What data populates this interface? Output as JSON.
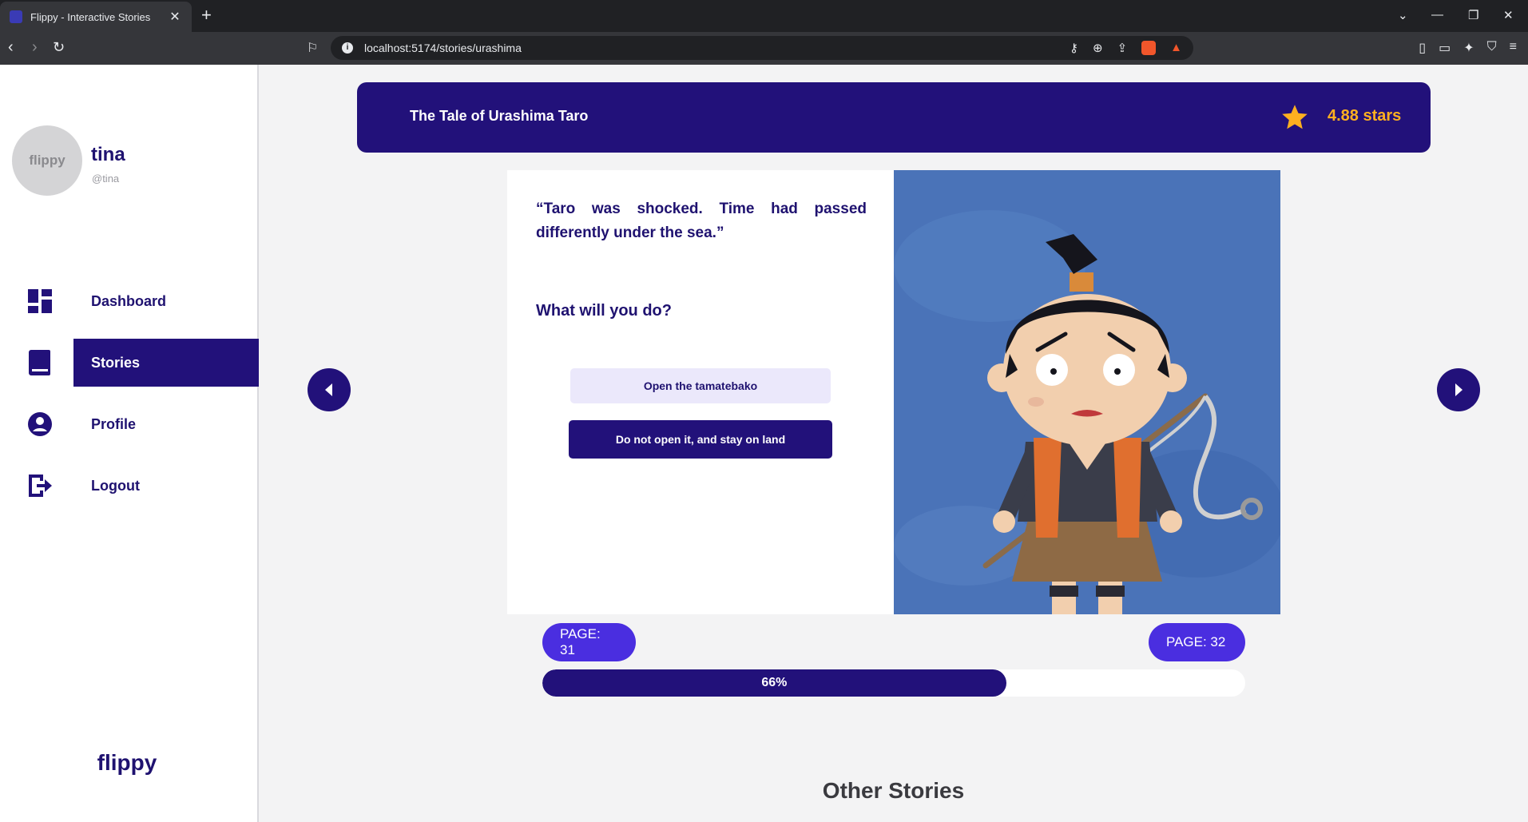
{
  "browser": {
    "tab_title": "Flippy - Interactive Stories",
    "tab_close": "✕",
    "new_tab": "+",
    "url": "localhost:5174/stories/urashima"
  },
  "sidebar": {
    "avatar_text": "flippy",
    "user_name": "tina",
    "user_handle": "@tina",
    "items": [
      {
        "label": "Dashboard",
        "icon": "dashboard-icon",
        "active": false
      },
      {
        "label": "Stories",
        "icon": "book-icon",
        "active": true
      },
      {
        "label": "Profile",
        "icon": "account-icon",
        "active": false
      },
      {
        "label": "Logout",
        "icon": "logout-icon",
        "active": false
      }
    ],
    "brand": "flippy"
  },
  "story": {
    "title": "The Tale of Urashima Taro",
    "rating": "4.88 stars",
    "text": "“Taro was shocked. Time had passed differently under the sea.”",
    "prompt": "What will you do?",
    "choices": [
      "Open the tamatebako",
      "Do not open it, and stay on land"
    ],
    "page_left": "PAGE: 31",
    "page_right": "PAGE: 32",
    "progress": 0.66,
    "progress_label": "66%"
  },
  "other_stories_heading": "Other Stories",
  "colors": {
    "primary": "#22117a",
    "accent": "#4a2ee0",
    "star": "#ffb020",
    "illustration_bg": "#4a73b8"
  }
}
